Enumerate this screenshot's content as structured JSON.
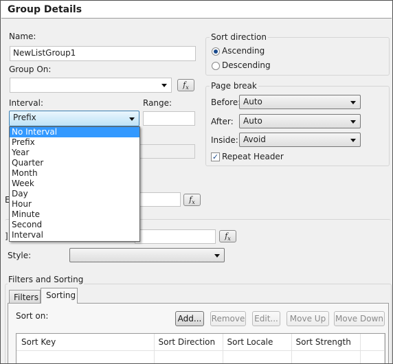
{
  "title": "Group Details",
  "name": {
    "label": "Name:",
    "value": "NewListGroup1"
  },
  "group_on": {
    "label": "Group On:",
    "value": "",
    "fx": "fx"
  },
  "interval": {
    "label": "Interval:",
    "value": "Prefix",
    "options": [
      "No Interval",
      "Prefix",
      "Year",
      "Quarter",
      "Month",
      "Week",
      "Day",
      "Hour",
      "Minute",
      "Second",
      "Interval"
    ],
    "highlighted": "No Interval"
  },
  "range": {
    "label": "Range:",
    "value": ""
  },
  "hidden_labels": {
    "e": "E",
    "i": "]"
  },
  "style": {
    "label": "Style:",
    "value": ""
  },
  "sort_direction": {
    "label": "Sort direction",
    "options": [
      "Ascending",
      "Descending"
    ],
    "selected": "Ascending"
  },
  "page_break": {
    "label": "Page break",
    "before_label": "Before:",
    "before": "Auto",
    "after_label": "After:",
    "after": "Auto",
    "inside_label": "Inside:",
    "inside": "Avoid",
    "repeat_header": "Repeat Header",
    "repeat_checked": true
  },
  "filters_sorting": {
    "label": "Filters and Sorting",
    "tabs": [
      "Filters",
      "Sorting"
    ],
    "active_tab": "Sorting",
    "sort_on": "Sort on:",
    "buttons": [
      "Add...",
      "Remove",
      "Edit...",
      "Move Up",
      "Move Down"
    ],
    "columns": [
      "Sort Key",
      "Sort Direction",
      "Sort Locale",
      "Sort Strength"
    ]
  },
  "colors": {
    "highlight": "#3399ff",
    "radio": "#1a4a8c"
  }
}
